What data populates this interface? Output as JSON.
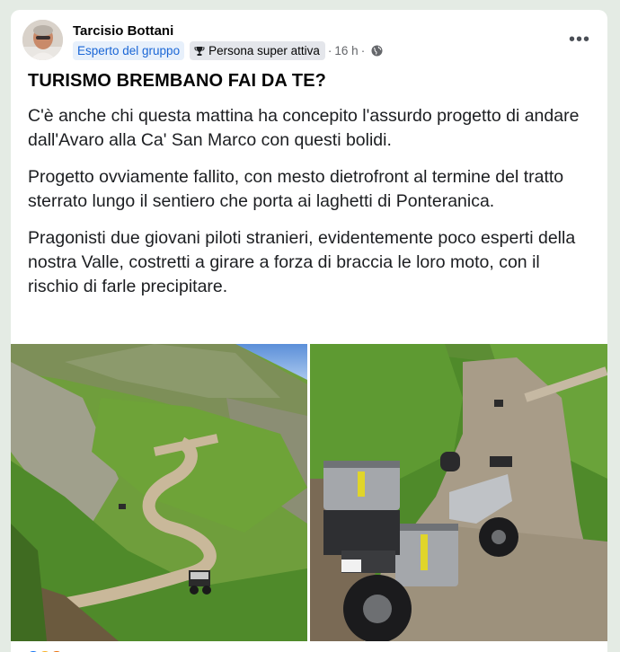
{
  "post": {
    "author": "Tarcisio Bottani",
    "badge_expert": "Esperto del gruppo",
    "badge_active": "Persona super attiva",
    "separator": "·",
    "time": "16 h",
    "separator2": "·",
    "more_label": "•••",
    "headline": "TURISMO BREMBANO FAI DA TE?",
    "paragraphs": [
      "C'è anche chi questa mattina ha concepito l'assurdo progetto di andare dall'Avaro alla Ca' San Marco con questi bolidi.",
      "Progetto ovviamente fallito, con mesto dietrofront al termine del tratto sterrato lungo il sentiero che porta ai laghetti di Ponteranica.",
      "Pragonisti due giovani piloti stranieri, evidentemente poco esperti della nostra Valle, costretti a girare a forza di braccia le loro moto, con il rischio di farle precipitare."
    ]
  },
  "icons": {
    "trophy": "trophy-icon",
    "globe": "globe-icon",
    "more": "more-options-icon"
  },
  "colors": {
    "page_bg": "#e4ebe4",
    "card_bg": "#ffffff",
    "badge_expert_text": "#1a66d6",
    "badge_expert_bg": "#e7f0fb",
    "meta_text": "#65676b"
  }
}
